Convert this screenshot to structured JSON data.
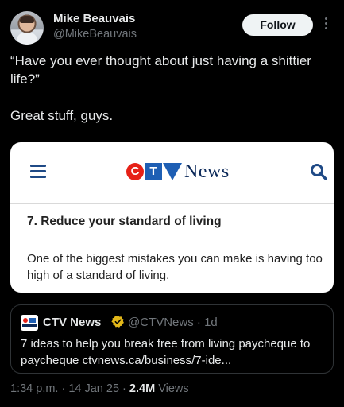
{
  "author": {
    "name": "Mike Beauvais",
    "handle": "@MikeBeauvais",
    "follow_label": "Follow"
  },
  "tweet": {
    "line1": "“Have you ever thought about just having a shittier life?”",
    "line2": "Great stuff, guys."
  },
  "card": {
    "logo_letters": [
      "C",
      "T",
      "V"
    ],
    "logo_word": "News",
    "heading": "7. Reduce your standard of living",
    "body": "One of the biggest mistakes you can make is having too high of a standard of living."
  },
  "quote": {
    "name": "CTV News",
    "handle_time": "@CTVNews · 1d",
    "text": "7 ideas to help you break free from living paycheque to paycheque ctvnews.ca/business/7-ide..."
  },
  "meta": {
    "time_date": "1:34 p.m. · 14 Jan 25 · ",
    "views_count": "2.4M",
    "views_label": " Views"
  },
  "colors": {
    "background": "#000000",
    "accent_ctv_red": "#e62117",
    "accent_ctv_blue": "#1e5fb4",
    "verified_gold": "#e2b719"
  }
}
